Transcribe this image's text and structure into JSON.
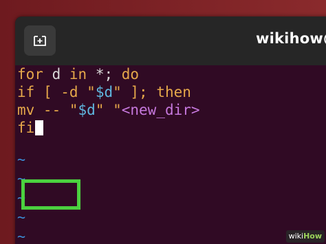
{
  "colors": {
    "desktop_bg": "#7a1e22",
    "terminal_bg": "#300a24",
    "titlebar_bg": "#262626",
    "keyword": "#e6a84a",
    "variable": "#5fb7e0",
    "string": "#c678dd",
    "tilde": "#3b8fd9",
    "highlight": "#4bd13f"
  },
  "titlebar": {
    "new_tab_icon": "new-tab-icon",
    "title": "wikihow@"
  },
  "editor": {
    "lines": [
      {
        "tokens": [
          {
            "text": "for",
            "cls": "kw"
          },
          {
            "text": " d ",
            "cls": "pl"
          },
          {
            "text": "in",
            "cls": "kw"
          },
          {
            "text": " *; ",
            "cls": "pl"
          },
          {
            "text": "do",
            "cls": "kw"
          }
        ]
      },
      {
        "tokens": [
          {
            "text": "if",
            "cls": "kw"
          },
          {
            "text": " [ -d \"",
            "cls": "kw"
          },
          {
            "text": "$d",
            "cls": "var"
          },
          {
            "text": "\" ]; ",
            "cls": "kw"
          },
          {
            "text": "then",
            "cls": "kw"
          }
        ]
      },
      {
        "tokens": [
          {
            "text": "mv -- \"",
            "cls": "kw"
          },
          {
            "text": "$d",
            "cls": "var"
          },
          {
            "text": "\" \"",
            "cls": "kw"
          },
          {
            "text": "<new_dir>",
            "cls": "str"
          }
        ]
      },
      {
        "tokens": [
          {
            "text": "fi",
            "cls": "kw"
          }
        ],
        "cursor": true
      }
    ],
    "empty_line_marker": "~",
    "empty_line_count": 5
  },
  "watermark": {
    "wiki": "wiki",
    "how": "How"
  }
}
